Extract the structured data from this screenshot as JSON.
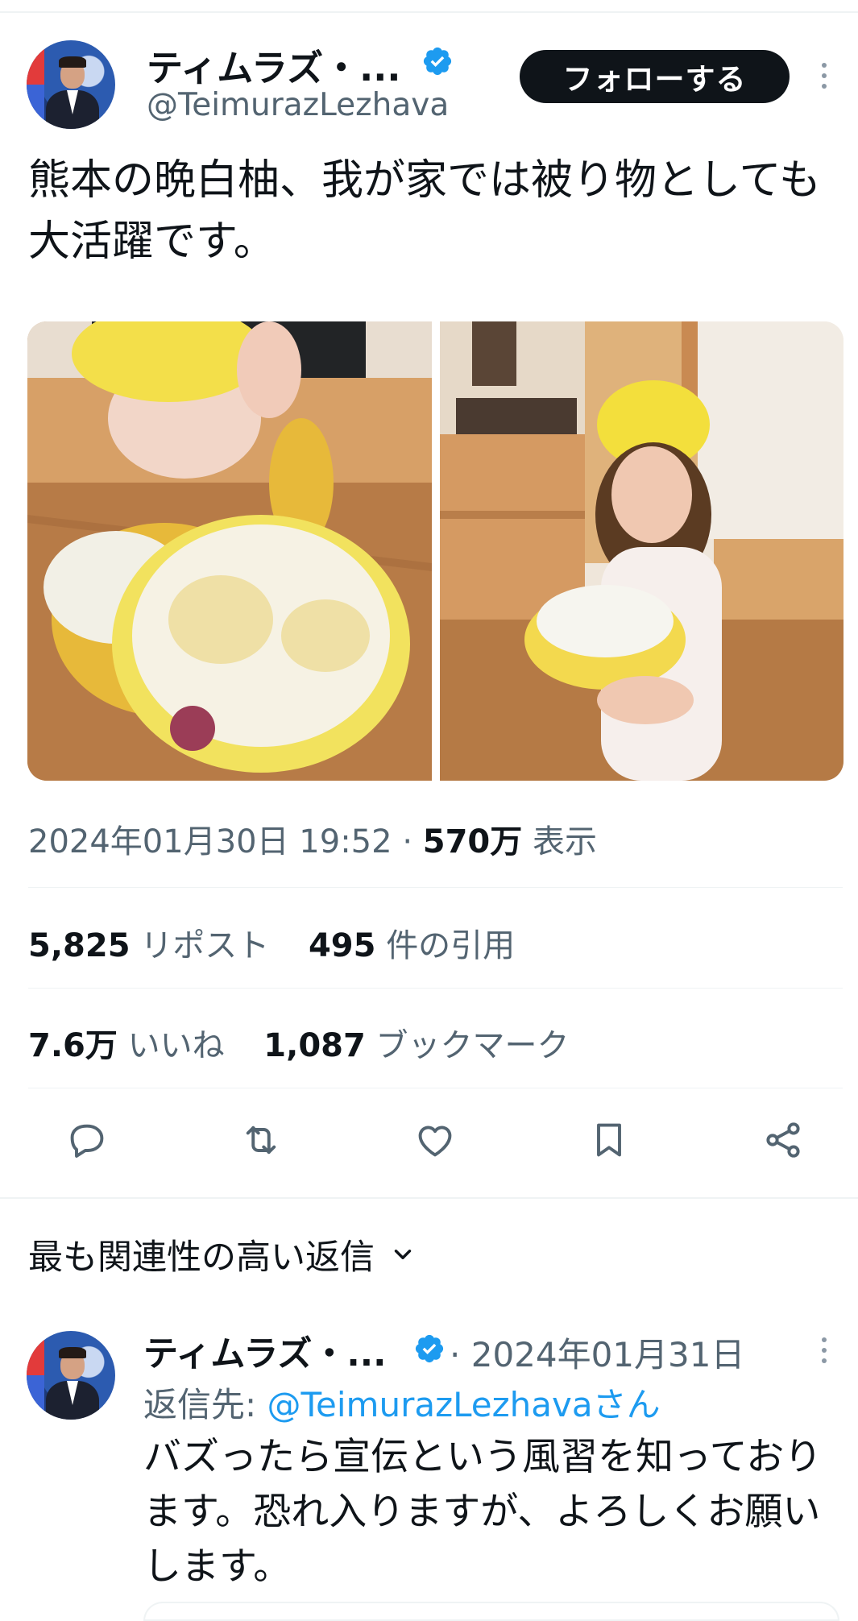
{
  "tweet": {
    "author": {
      "name": "ティムラズ・...",
      "handle": "@TeimurazLezhava"
    },
    "follow_label": "フォローする",
    "text": "熊本の晩白柚、我が家では被り物としても大活躍です。",
    "timestamp": "2024年01月30日 19:52",
    "separator": "·",
    "views_count": "570万",
    "views_label": "表示",
    "reposts_count": "5,825",
    "reposts_label": "リポスト",
    "quotes_count": "495",
    "quotes_label": "件の引用",
    "likes_count": "7.6万",
    "likes_label": "いいね",
    "bookmarks_count": "1,087",
    "bookmarks_label": "ブックマーク"
  },
  "replies_sort": {
    "label": "最も関連性の高い返信"
  },
  "reply": {
    "author_name": "ティムラズ・...",
    "separator": "·",
    "date": "2024年01月31日",
    "reply_to_prefix": "返信先: ",
    "reply_to_handle": "@TeimurazLezhavaさん",
    "text": "バズったら宣伝という風習を知っております。恐れ入りますが、よろしくお願いします。"
  },
  "colors": {
    "verified": "#1d9bf0",
    "link": "#1d9bf0",
    "muted_text": "#536471",
    "primary_text": "#0f1419",
    "follow_button_bg": "#0f1419"
  },
  "icons": [
    "verified-badge-icon",
    "more-options-icon",
    "reply-icon",
    "retweet-icon",
    "like-icon",
    "bookmark-icon",
    "share-icon",
    "chevron-down-icon"
  ]
}
